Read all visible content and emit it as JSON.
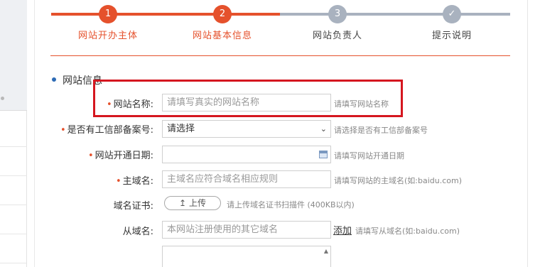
{
  "steps": [
    {
      "num": "1",
      "label": "网站开办主体",
      "state": "done"
    },
    {
      "num": "2",
      "label": "网站基本信息",
      "state": "done"
    },
    {
      "num": "3",
      "label": "网站负责人",
      "state": "todo"
    },
    {
      "num": "✓",
      "label": "提示说明",
      "state": "todo"
    }
  ],
  "section": {
    "title": "网站信息"
  },
  "form": {
    "site_name": {
      "required": "•",
      "label": "网站名称:",
      "placeholder": "请填写真实的网站名称",
      "hint": "请填写网站名称"
    },
    "icp": {
      "required": "•",
      "label": "是否有工信部备案号:",
      "value": "请选择",
      "hint": "请选择是否有工信部备案号"
    },
    "open_date": {
      "required": "•",
      "label": "网站开通日期:",
      "value": "",
      "hint": "请填写网站开通日期"
    },
    "main_domain": {
      "required": "•",
      "label": "主域名:",
      "placeholder": "主域名应符合域名相应规则",
      "hint": "请填写网站的主域名(如:baidu.com)"
    },
    "domain_cert": {
      "label": "域名证书:",
      "button": "上传",
      "hint": "请上传域名证书扫描件 (400KB以内)"
    },
    "sub_domain": {
      "label": "从域名:",
      "placeholder": "本网站注册使用的其它域名",
      "add_link": "添加",
      "hint": "请填写从域名(如:baidu.com)"
    }
  },
  "icons": {
    "upload": "upload-icon",
    "calendar": "calendar-icon",
    "dropdown": "chevron-down-icon",
    "check": "check-icon"
  },
  "colors": {
    "accent": "#e5512c",
    "inactive": "#a9b2bf",
    "highlight": "#d5161f",
    "section_dot": "#2d6bb5"
  }
}
